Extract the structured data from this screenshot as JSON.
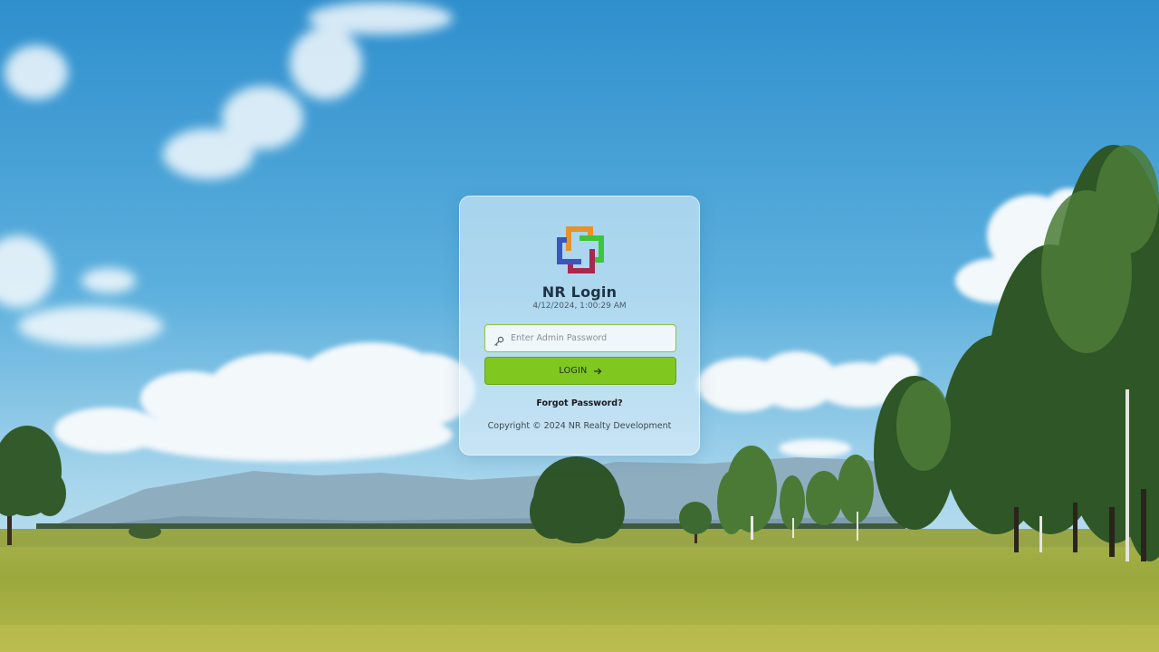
{
  "login": {
    "title": "NR Login",
    "datetime": "4/12/2024, 1:00:29 AM",
    "password_placeholder": "Enter Admin Password",
    "login_button_label": "LOGIN",
    "forgot_password": "Forgot Password?",
    "copyright": "Copyright © 2024 NR Realty Development"
  },
  "icons": {
    "logo": "interlocking-squares-logo",
    "password": "key-icon",
    "login": "arrow-right-icon"
  },
  "colors": {
    "accent": "#80c71f",
    "field_border": "#8cc63f",
    "logo_orange": "#e8922a",
    "logo_green": "#3cc63c",
    "logo_blue": "#3a55c0",
    "logo_crimson": "#a8284e"
  }
}
